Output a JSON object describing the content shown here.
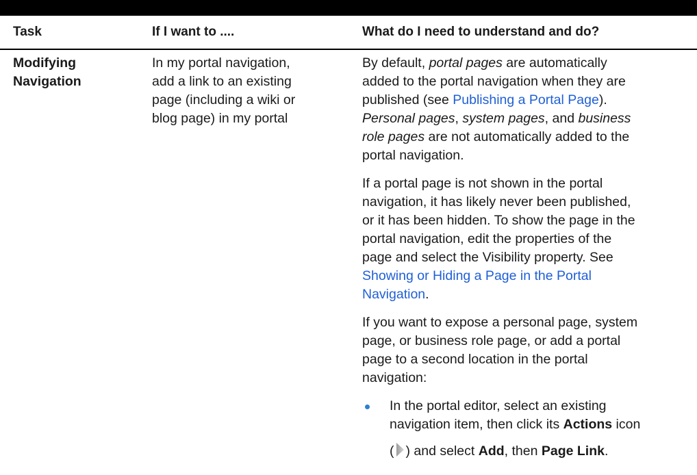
{
  "table": {
    "headers": {
      "task": "Task",
      "if_i_want": "If I want to ....",
      "what_to_do": "What do I need to understand and do?"
    },
    "row": {
      "task_lines": [
        "Modifying",
        "Navigation"
      ],
      "want_lines": [
        "In my portal navigation,",
        "add a link to an existing",
        "page (including a wiki or",
        "blog page) in my portal"
      ],
      "p1": {
        "by_default": "By default, ",
        "portal_pages": "portal pages",
        "are_auto": " are automatically",
        "line2": "added to the portal navigation when they are",
        "published_see": "published (see ",
        "link_publishing": "Publishing a Portal Page",
        "close": ").",
        "personal_pages": "Personal pages",
        "comma1": ", ",
        "system_pages": "system pages",
        "and_space": ", and ",
        "business": "business",
        "role_pages": "role pages",
        "not_auto": " are not automatically added to the",
        "portal_nav": "portal navigation."
      },
      "p2": {
        "line1": "If a portal page is not shown in the portal",
        "line2": "navigation, it has likely never been published,",
        "line3": "or it has been hidden. To show the page in the",
        "line4": "portal navigation, edit the properties of the",
        "line5": "page and select the Visibility property. See",
        "link_line1": "Showing or Hiding a Page in the Portal",
        "link_line2": "Navigation",
        "period": "."
      },
      "p3": {
        "line1": "If you want to expose a personal page, system",
        "line2": "page, or business role page, or add a portal",
        "line3": "page to a second location in the portal",
        "line4": "navigation:"
      },
      "bullet": {
        "line1": "In the portal editor, select an existing",
        "line2a": "navigation item, then click its ",
        "actions": "Actions",
        "line2b": " icon",
        "open_paren": "(",
        "and_select": ") and select ",
        "add": "Add",
        "then": ", then ",
        "page_link": "Page Link",
        "period": "."
      }
    }
  },
  "colors": {
    "link": "#1f5fd6",
    "bullet": "#2f7fd0",
    "rule": "#000000"
  },
  "icons": [
    "bullet-icon",
    "actions-icon"
  ]
}
